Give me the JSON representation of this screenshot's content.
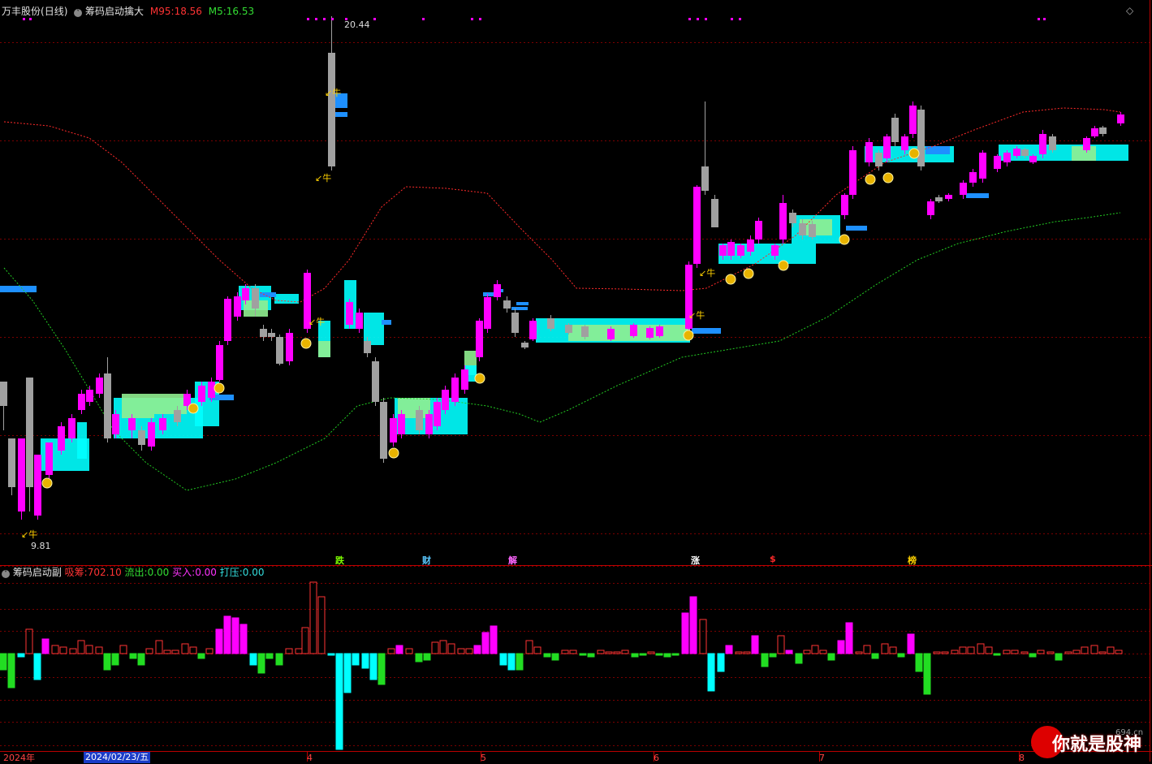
{
  "header": {
    "stock_title": "万丰股份",
    "period": "(日线)",
    "indicator_name": "筹码启动擒大",
    "m95_label": "M95:",
    "m95_value": "18.56",
    "m5_label": "M5:",
    "m5_value": "16.53"
  },
  "main_chart": {
    "high_label": "20.44",
    "low_label": "9.81",
    "bull_marker": "牛",
    "event_labels": [
      {
        "text": "跌",
        "color": "#7cfc00"
      },
      {
        "text": "财",
        "color": "#5ac8ff"
      },
      {
        "text": "解",
        "color": "#ff66ff"
      },
      {
        "text": "涨",
        "color": "#ffffff"
      },
      {
        "text": "$",
        "color": "#ff2a2a"
      },
      {
        "text": "榜",
        "color": "#ffd200"
      }
    ]
  },
  "sub_header": {
    "indicator_name": "筹码启动副",
    "absorb_label": "吸筹:",
    "absorb_value": "702.10",
    "outflow_label": "流出:",
    "outflow_value": "0.00",
    "buy_label": "买入:",
    "buy_value": "0.00",
    "press_label": "打压:",
    "press_value": "0.00"
  },
  "axis": {
    "labels": [
      "2024年",
      "2024/02/23/五",
      "4",
      "5",
      "6",
      "7",
      "8"
    ]
  },
  "watermark": {
    "text": "你就是股神",
    "site": "694.cn"
  },
  "colors": {
    "up": "#ff00ff",
    "down": "#a0a0a0",
    "cyan": "#00ffff",
    "blue": "#1e90ff",
    "green_band": "#90ee90",
    "red_line": "#ff2a2a",
    "green_line": "#22cc22",
    "grid": "#7a0000"
  }
}
